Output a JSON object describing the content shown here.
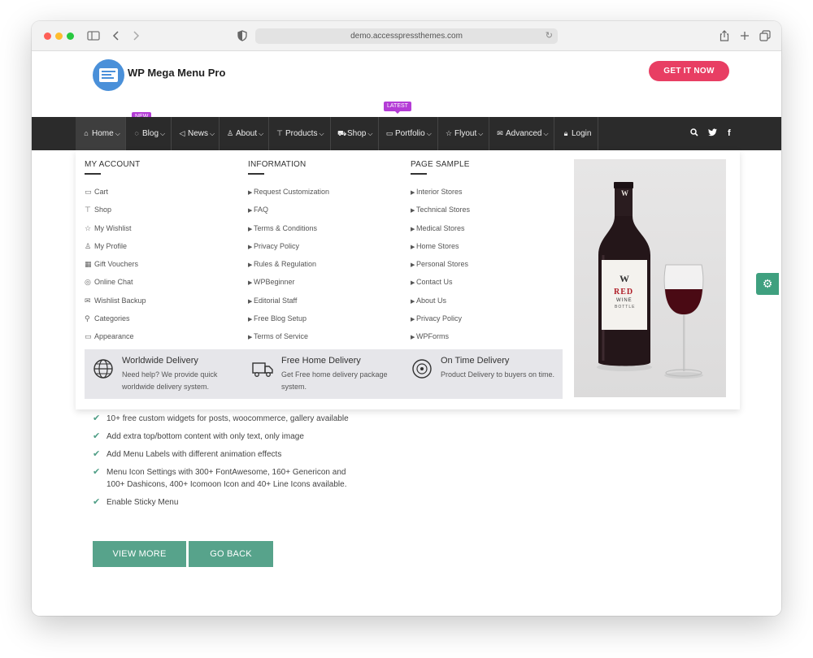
{
  "browser": {
    "url": "demo.accesspressthemes.com"
  },
  "header": {
    "logo_text": "WP Mega Menu Pro",
    "cta_label": "GET IT NOW"
  },
  "nav": {
    "items": [
      {
        "label": "Home",
        "icon": "home-icon"
      },
      {
        "label": "Blog",
        "icon": "comment-icon",
        "badge": "NEW"
      },
      {
        "label": "News",
        "icon": "megaphone-icon"
      },
      {
        "label": "About",
        "icon": "user-icon"
      },
      {
        "label": "Products",
        "icon": "shirt-icon"
      },
      {
        "label": "Shop",
        "icon": "cart-icon"
      },
      {
        "label": "Portfolio",
        "icon": "tag-icon",
        "badge": "LATEST"
      },
      {
        "label": "Flyout",
        "icon": "star-icon"
      },
      {
        "label": "Advanced",
        "icon": "mail-icon"
      },
      {
        "label": "Login",
        "icon": "lock-icon"
      }
    ]
  },
  "mega": {
    "account": {
      "title": "MY ACCOUNT",
      "items": [
        "Cart",
        "Shop",
        "My Wishlist",
        "My Profile",
        "Gift Vouchers",
        "Online Chat",
        "Wishlist Backup",
        "Categories",
        "Appearance"
      ]
    },
    "information": {
      "title": "INFORMATION",
      "items": [
        "Request Customization",
        "FAQ",
        "Terms & Conditions",
        "Privacy Policy",
        "Rules & Regulation",
        "WPBeginner",
        "Editorial Staff",
        "Free Blog Setup",
        "Terms of Service"
      ]
    },
    "pages": {
      "title": "PAGE SAMPLE",
      "items": [
        "Interior Stores",
        "Technical Stores",
        "Medical Stores",
        "Home Stores",
        "Personal Stores",
        "Contact Us",
        "About Us",
        "Privacy Policy",
        "WPForms"
      ]
    },
    "features": [
      {
        "title": "Worldwide Delivery",
        "desc": "Need help? We provide quick worldwide delivery system."
      },
      {
        "title": "Free Home Delivery",
        "desc": "Get Free home delivery package system."
      },
      {
        "title": "On Time Delivery",
        "desc": "Product Delivery to buyers on time."
      }
    ],
    "image": {
      "label_top": "W",
      "label_red": "RED",
      "label_sub": "WINE",
      "label_small": "BOTTLE"
    }
  },
  "checklist": [
    "10+ free custom widgets for posts, woocommerce, gallery available",
    "Add extra top/bottom content with only text, only image",
    "Add Menu Labels with different animation effects",
    "Menu Icon Settings with 300+ FontAwesome, 160+ Genericon and 100+ Dashicons, 400+ Icomoon Icon and 40+ Line Icons available.",
    "Enable Sticky Menu"
  ],
  "buttons": {
    "view_more": "VIEW MORE",
    "go_back": "GO BACK"
  },
  "colors": {
    "nav_bg": "#2b2b2b",
    "cta": "#e83e63",
    "badge": "#b43cd6",
    "accent_green": "#57a38b"
  }
}
